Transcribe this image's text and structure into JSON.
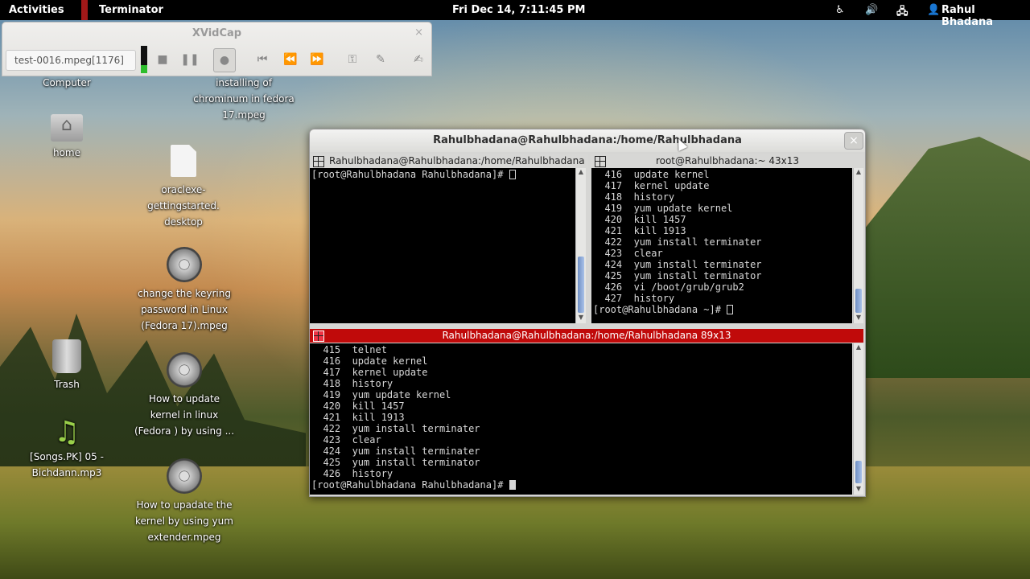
{
  "topbar": {
    "activities": "Activities",
    "app_name": "Terminator",
    "clock": "Fri Dec 14,  7:11:45 PM",
    "user": "Rahul Bhadana",
    "icons": [
      "accessibility-icon",
      "volume-icon",
      "network-icon",
      "user-icon"
    ]
  },
  "xvidcap": {
    "title": "XVidCap",
    "close": "×",
    "file": "test-0016.mpeg[1176]",
    "buttons": [
      "stop-icon",
      "pause-icon",
      "record-icon",
      "rewind-start-icon",
      "rewind-icon",
      "forward-icon",
      "settings-icon",
      "edit-icon",
      "notes-icon"
    ]
  },
  "desktop": {
    "computer": "Computer",
    "home": "home",
    "oracle": [
      "oraclexe-",
      "gettingstarted.",
      "desktop"
    ],
    "chromium": [
      "installing of",
      "chrominum in fedora",
      "17.mpeg"
    ],
    "keyring": [
      "change the keyring",
      "password in Linux",
      "(Fedora 17).mpeg"
    ],
    "trash": "Trash",
    "update_kernel": [
      "How to update",
      "kernel in linux",
      "(Fedora ) by using ..."
    ],
    "songs": [
      "[Songs.PK] 05 -",
      "Bichdann.mp3"
    ],
    "yum_extender": [
      "How to upadate the",
      "kernel by using yum",
      "extender.mpeg"
    ]
  },
  "terminator": {
    "window_title": "Rahulbhadana@Rahulbhadana:/home/Rahulbhadana",
    "close": "×",
    "pane1": {
      "title": "Rahulbhadana@Rahulbhadana:/home/Rahulbhadana",
      "prompt": "[root@Rahulbhadana Rahulbhadana]# "
    },
    "pane2": {
      "title": "root@Rahulbhadana:~ 43x13",
      "lines": [
        "  416  update kernel",
        "  417  kernel update",
        "  418  history",
        "  419  yum update kernel",
        "  420  kill 1457",
        "  421  kill 1913",
        "  422  yum install terminater",
        "  423  clear",
        "  424  yum install terminater",
        "  425  yum install terminator",
        "  426  vi /boot/grub/grub2",
        "  427  history"
      ],
      "prompt": "[root@Rahulbhadana ~]# "
    },
    "pane3": {
      "title": "Rahulbhadana@Rahulbhadana:/home/Rahulbhadana 89x13",
      "lines": [
        "  415  telnet",
        "  416  update kernel",
        "  417  kernel update",
        "  418  history",
        "  419  yum update kernel",
        "  420  kill 1457",
        "  421  kill 1913",
        "  422  yum install terminater",
        "  423  clear",
        "  424  yum install terminater",
        "  425  yum install terminator",
        "  426  history"
      ],
      "prompt": "[root@Rahulbhadana Rahulbhadana]# "
    }
  },
  "colors": {
    "topbar": "#000000",
    "active_pane_title": "#c00a0a",
    "terminal_bg": "#000000",
    "terminal_fg": "#d8d8d8"
  }
}
